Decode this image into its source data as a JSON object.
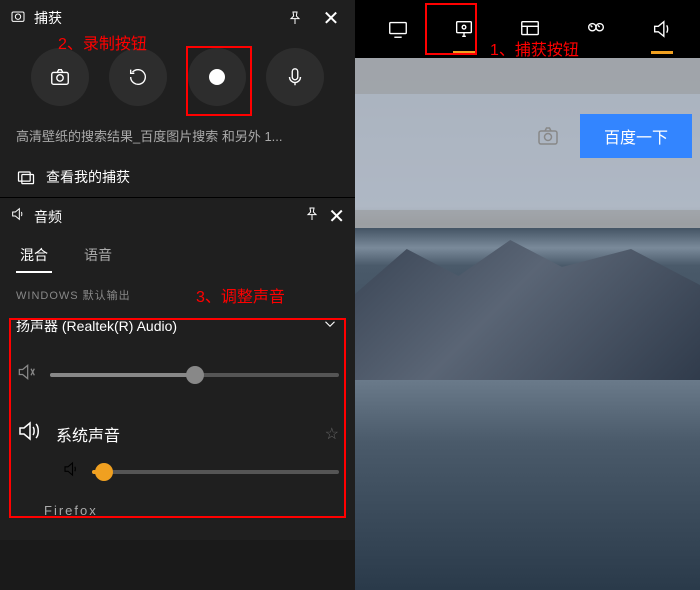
{
  "toolbar": {
    "buttons": [
      "cast",
      "capture",
      "widgets",
      "perf",
      "volume"
    ]
  },
  "search": {
    "button_label": "百度一下"
  },
  "capture_panel": {
    "title": "捕获",
    "desc": "高清壁纸的搜索结果_百度图片搜索 和另外 1...",
    "view_captures": "查看我的捕获"
  },
  "audio_panel": {
    "title": "音频",
    "tabs": [
      "混合",
      "语音"
    ],
    "section_label": "WINDOWS 默认输出",
    "device": "扬声器 (Realtek(R) Audio)",
    "master_volume_pct": 50,
    "system_sound_label": "系统声音",
    "system_volume_pct": 5,
    "truncated_app": "Firefox"
  },
  "annotations": {
    "a1": "1、捕获按钮",
    "a2": "2、录制按钮",
    "a3": "3、调整声音"
  }
}
